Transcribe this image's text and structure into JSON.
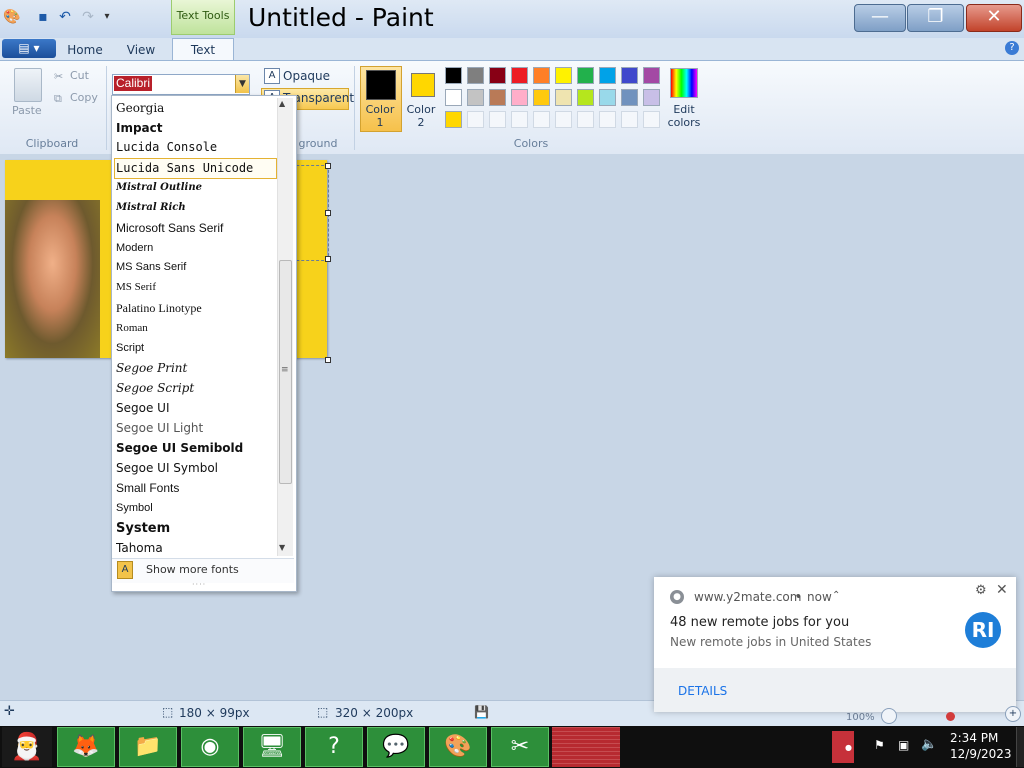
{
  "window": {
    "title": "Untitled - Paint",
    "context_tab": "Text Tools",
    "buttons": {
      "minimize": "—",
      "maximize": "❐",
      "close": "✕"
    }
  },
  "tabs": [
    {
      "label": "Home"
    },
    {
      "label": "View"
    },
    {
      "label": "Text"
    }
  ],
  "ribbon": {
    "clipboard": {
      "paste": "Paste",
      "cut": "Cut",
      "copy": "Copy",
      "group": "Clipboard"
    },
    "font": {
      "current": "Calibri"
    },
    "background": {
      "opaque": "Opaque",
      "transparent": "Transparent",
      "group": "ground"
    },
    "colors": {
      "color1": "Color 1",
      "color2": "Color 2",
      "edit": "Edit colors",
      "group": "Colors",
      "color1_value": "#000000",
      "color2_value": "#ffd700",
      "palette_row1": [
        "#000000",
        "#7f7f7f",
        "#880015",
        "#ed1c24",
        "#ff7f27",
        "#fff200",
        "#22b14c",
        "#00a2e8",
        "#3f48cc",
        "#a349a4"
      ],
      "palette_row2": [
        "#ffffff",
        "#c3c3c3",
        "#b97a57",
        "#ffaec9",
        "#ffc90e",
        "#efe4b0",
        "#b5e61d",
        "#99d9ea",
        "#7092be",
        "#c8bfe7"
      ],
      "palette_row3": [
        "#ffd700",
        "",
        "",
        "",
        "",
        "",
        "",
        "",
        "",
        ""
      ]
    }
  },
  "font_dropdown": {
    "items": [
      {
        "label": "Georgia",
        "family": "DejaVu Serif"
      },
      {
        "label": "Impact",
        "family": "DejaVu Sans",
        "bold": true
      },
      {
        "label": "Lucida Console",
        "family": "DejaVu Sans Mono"
      },
      {
        "label": "Lucida Sans Unicode",
        "family": "DejaVu Sans Mono",
        "hovered": true
      },
      {
        "label": "Mistral Outline",
        "family": "DejaVu Serif",
        "decorative": true
      },
      {
        "label": "Mistral Rich",
        "family": "DejaVu Serif",
        "decorative": true
      },
      {
        "label": "Microsoft Sans Serif",
        "family": "Liberation Sans"
      },
      {
        "label": "Modern",
        "family": "Liberation Sans",
        "small": true
      },
      {
        "label": "MS Sans Serif",
        "family": "Liberation Sans",
        "small": true
      },
      {
        "label": "MS Serif",
        "family": "Liberation Serif",
        "small": true
      },
      {
        "label": "Palatino Linotype",
        "family": "Liberation Serif"
      },
      {
        "label": "Roman",
        "family": "Liberation Serif",
        "small": true
      },
      {
        "label": "Script",
        "family": "Liberation Sans",
        "small": true
      },
      {
        "label": "Segoe Print",
        "family": "DejaVu Serif",
        "italic": true
      },
      {
        "label": "Segoe Script",
        "family": "DejaVu Serif",
        "italic": true
      },
      {
        "label": "Segoe UI",
        "family": "DejaVu Sans"
      },
      {
        "label": "Segoe UI Light",
        "family": "DejaVu Sans",
        "light": true
      },
      {
        "label": "Segoe UI Semibold",
        "family": "DejaVu Sans",
        "semibold": true
      },
      {
        "label": "Segoe UI Symbol",
        "family": "DejaVu Sans"
      },
      {
        "label": "Small Fonts",
        "family": "Liberation Sans"
      },
      {
        "label": "Symbol",
        "family": "Liberation Sans",
        "small": true
      },
      {
        "label": "System",
        "family": "DejaVu Sans",
        "bold": true,
        "large": true
      },
      {
        "label": "Tahoma",
        "family": "DejaVu Sans"
      }
    ],
    "show_more": "Show more fonts"
  },
  "statusbar": {
    "selection_size": "180 × 99px",
    "canvas_size": "320 × 200px",
    "zoom": "100%"
  },
  "notification": {
    "source": "www.y2mate.com",
    "time": "now",
    "title": "48 new remote jobs for you",
    "body": "New remote jobs in United States",
    "badge": "RI",
    "action": "DETAILS"
  },
  "taskbar": {
    "time": "2:34 PM",
    "date": "12/9/2023"
  }
}
